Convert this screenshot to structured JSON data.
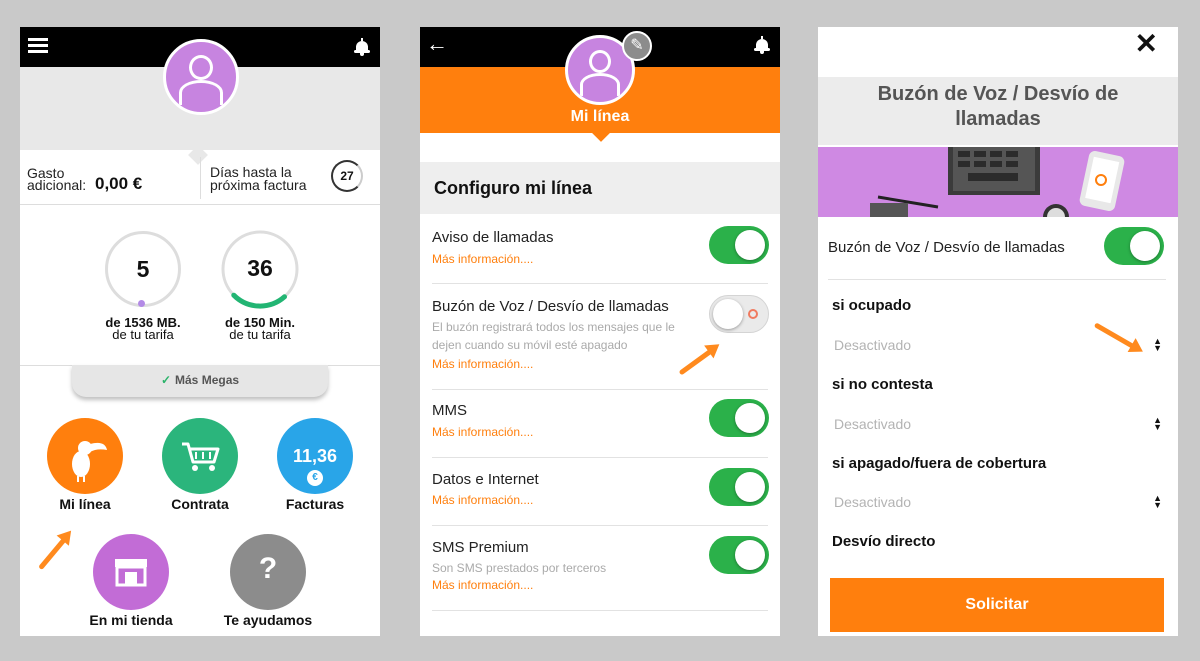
{
  "screen1": {
    "gasto_label_1": "Gasto",
    "gasto_label_2": "adicional:",
    "gasto_value": "0,00 €",
    "dias_label_1": "Días hasta la",
    "dias_label_2": "próxima factura",
    "dias_value": "27",
    "data_value": "5",
    "data_label_1": "de 1536 MB.",
    "data_label_2": "de tu tarifa",
    "data_used_fraction": 0.0033,
    "min_value": "36",
    "min_label_1": "de 150 Min.",
    "min_label_2": "de tu tarifa",
    "min_used_fraction": 0.24,
    "mas_megas": "Más Megas",
    "menu": [
      {
        "label": "Mi línea",
        "color": "#ff7f0d",
        "icon": "toucan-icon"
      },
      {
        "label": "Contrata",
        "color": "#2bb57c",
        "icon": "cart-icon"
      },
      {
        "label": "Facturas",
        "color": "#29a5e8",
        "icon": "euro-icon",
        "amount": "11,36",
        "currency": "€"
      },
      {
        "label": "En mi tienda",
        "color": "#c26cd6",
        "icon": "store-icon"
      },
      {
        "label": "Te ayudamos",
        "color": "#8c8c8c",
        "icon": "question-icon",
        "glyph": "?"
      }
    ]
  },
  "screen2": {
    "header": "Mi línea",
    "section_title": "Configuro mi línea",
    "rows": [
      {
        "title": "Aviso de llamadas",
        "desc": "",
        "link": "Más información....",
        "enabled": true
      },
      {
        "title": "Buzón de Voz / Desvío de llamadas",
        "desc_1": "El buzón registrará todos los mensajes que le",
        "desc_2": "dejen cuando su móvil esté apagado",
        "link": "Más información....",
        "enabled": false
      },
      {
        "title": "MMS",
        "desc": "",
        "link": "Más información....",
        "enabled": true
      },
      {
        "title": "Datos e Internet",
        "desc": "",
        "link": "Más información....",
        "enabled": true
      },
      {
        "title": "SMS Premium",
        "desc": "Son SMS prestados por terceros",
        "link": "Más información....",
        "enabled": true
      }
    ]
  },
  "screen3": {
    "close": "✕",
    "title_1": "Buzón de Voz / Desvío de",
    "title_2": "llamadas",
    "toggle_label": "Buzón de Voz / Desvío de llamadas",
    "toggle_enabled": true,
    "fields": [
      {
        "label": "si ocupado",
        "value": "Desactivado"
      },
      {
        "label": "si no contesta",
        "value": "Desactivado"
      },
      {
        "label": "si apagado/fuera de cobertura",
        "value": "Desactivado"
      }
    ],
    "direct_label": "Desvío directo",
    "button": "Solicitar"
  },
  "colors": {
    "orange": "#ff7f0d",
    "green": "#2bb14a",
    "purple": "#c784e0",
    "black": "#000000"
  }
}
